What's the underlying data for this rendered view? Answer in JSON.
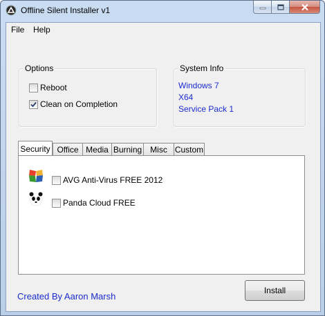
{
  "window": {
    "title": "Offline Silent Installer v1"
  },
  "menu": {
    "items": [
      "File",
      "Help"
    ]
  },
  "options": {
    "title": "Options",
    "checkboxes": [
      {
        "label": "Reboot",
        "checked": false
      },
      {
        "label": "Clean on Completion",
        "checked": true
      }
    ]
  },
  "system_info": {
    "title": "System Info",
    "lines": [
      "Windows 7",
      "X64",
      "Service Pack 1"
    ]
  },
  "tabs": {
    "labels": [
      "Security",
      "Office",
      "Media",
      "Burning",
      "Misc",
      "Custom"
    ],
    "active": "Security"
  },
  "security": {
    "items": [
      {
        "label": "AVG Anti-Virus FREE 2012",
        "icon": "avg-icon",
        "checked": false
      },
      {
        "label": "Panda Cloud FREE",
        "icon": "panda-icon",
        "checked": false
      }
    ]
  },
  "footer": {
    "credit": "Created By Aaron Marsh",
    "install_label": "Install"
  },
  "colors": {
    "link_blue": "#1b2bd0",
    "face": "#f0f0f0"
  }
}
